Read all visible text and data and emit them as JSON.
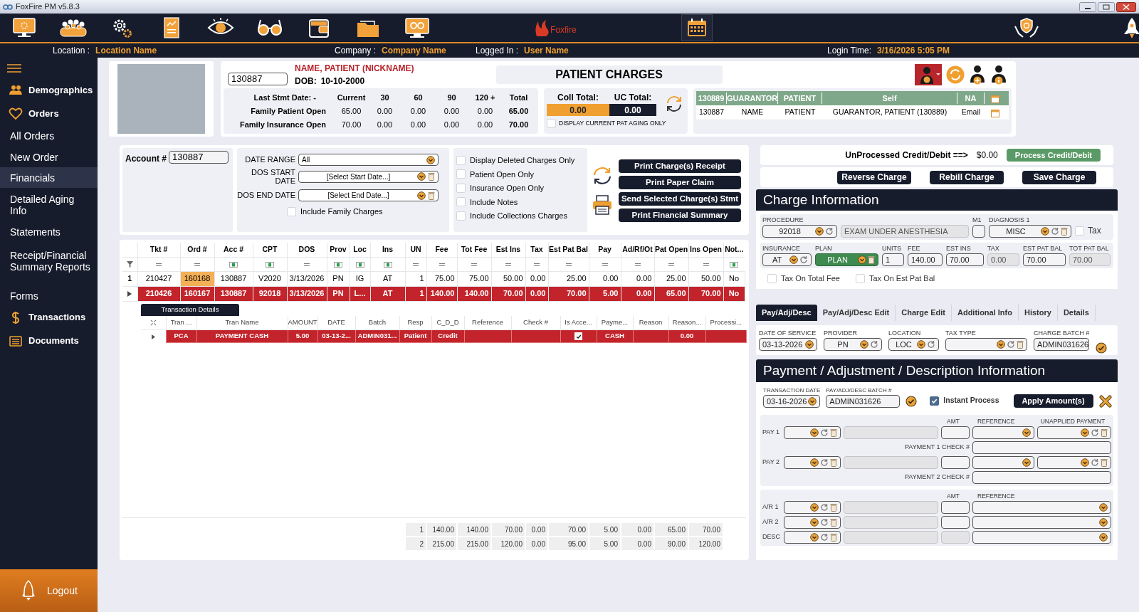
{
  "window": {
    "title": "FoxFire PM v5.8.3"
  },
  "toolbar": {
    "logo": "Foxfire",
    "tools": [
      {
        "selected": false
      },
      {
        "selected": false
      },
      {
        "selected": false
      },
      {
        "selected": false
      },
      {
        "selected": false
      },
      {
        "selected": false
      },
      {
        "selected": false
      },
      {
        "selected": false
      },
      {
        "selected": false
      },
      {
        "selected": true
      },
      {
        "selected": false
      },
      {
        "selected": false
      }
    ]
  },
  "info_bar": [
    {
      "label": "Location :",
      "value": "Location Name"
    },
    {
      "label": "Company :",
      "value": "Company Name"
    },
    {
      "label": "Logged In :",
      "value": "User Name"
    },
    {
      "label": "Login Time:",
      "value": "3/16/2026 5:05 PM"
    }
  ],
  "sidebar": {
    "items": [
      {
        "label": "Demographics",
        "kind": "section",
        "selected": false
      },
      {
        "label": "Orders",
        "kind": "section",
        "selected": false
      },
      {
        "label": "All Orders",
        "kind": "link",
        "selected": false
      },
      {
        "label": "New Order",
        "kind": "link",
        "selected": false
      },
      {
        "label": "Financials",
        "kind": "link",
        "selected": true
      },
      {
        "label": "Detailed Aging Info",
        "kind": "link",
        "selected": false
      },
      {
        "label": "Statements",
        "kind": "link",
        "selected": false
      },
      {
        "label": "Receipt/Financial Summary Reports",
        "kind": "link",
        "selected": false
      },
      {
        "label": "Forms",
        "kind": "link",
        "selected": false
      },
      {
        "label": "Transactions",
        "kind": "section",
        "selected": false
      },
      {
        "label": "Documents",
        "kind": "section",
        "selected": false
      }
    ],
    "logout": "Logout"
  },
  "patient": {
    "account": "130887",
    "name": "NAME, PATIENT (NICKNAME)",
    "dob_label": "DOB:",
    "dob": "10-10-2000"
  },
  "page_title": "PATIENT CHARGES",
  "aging": {
    "last_stmt": "Last Stmt Date: -",
    "columns": [
      "Current",
      "30",
      "60",
      "90",
      "120 +",
      "Total"
    ],
    "rows": [
      {
        "label": "Family Patient Open",
        "values": [
          "65.00",
          "0.00",
          "0.00",
          "0.00",
          "0.00",
          "65.00"
        ]
      },
      {
        "label": "Family Insurance Open",
        "values": [
          "70.00",
          "0.00",
          "0.00",
          "0.00",
          "0.00",
          "70.00"
        ]
      }
    ]
  },
  "collections": {
    "coll_label": "Coll Total:",
    "coll_value": "0.00",
    "uc_label": "UC Total:",
    "uc_value": "0.00",
    "current_aging_only": {
      "label": "DISPLAY CURRENT PAT AGING ONLY",
      "checked": false
    }
  },
  "guarantor_table": {
    "columns": [
      "130889",
      "GUARANTOR",
      "PATIENT",
      "Self",
      "NA"
    ],
    "rows": [
      [
        "130887",
        "NAME",
        "PATIENT",
        "GUARANTOR, PATIENT (130889)",
        "Email"
      ]
    ]
  },
  "filters": {
    "account_label": "Account #",
    "account": "130887",
    "date_range_label": "DATE RANGE",
    "date_range": "All",
    "dos_start_label": "DOS START DATE",
    "dos_start": "[Select Start Date...]",
    "dos_end_label": "DOS END DATE",
    "dos_end": "[Select End Date...]",
    "include_family": {
      "label": "Include Family Charges",
      "checked": false
    }
  },
  "options": [
    {
      "label": "Display Deleted Charges Only",
      "checked": false
    },
    {
      "label": "Patient Open Only",
      "checked": false
    },
    {
      "label": "Insurance Open Only",
      "checked": false
    },
    {
      "label": "Include Notes",
      "checked": false
    },
    {
      "label": "Include Collections Charges",
      "checked": false
    }
  ],
  "print_buttons": [
    "Print Charge(s) Receipt",
    "Print Paper Claim",
    "Send Selected Charge(s) Stmt",
    "Print Financial Summary"
  ],
  "charges": {
    "columns": [
      {
        "label": "Tkt #",
        "kind": "numeric"
      },
      {
        "label": "Ord #",
        "kind": "numeric"
      },
      {
        "label": "Acc #",
        "kind": "text"
      },
      {
        "label": "CPT",
        "kind": "text"
      },
      {
        "label": "DOS",
        "kind": "numeric"
      },
      {
        "label": "Prov",
        "kind": "text"
      },
      {
        "label": "Loc",
        "kind": "text"
      },
      {
        "label": "Ins",
        "kind": "text"
      },
      {
        "label": "UN",
        "kind": "numeric"
      },
      {
        "label": "Fee",
        "kind": "numeric"
      },
      {
        "label": "Tot Fee",
        "kind": "numeric"
      },
      {
        "label": "Est Ins",
        "kind": "numeric"
      },
      {
        "label": "Tax",
        "kind": "numeric"
      },
      {
        "label": "Est Pat Bal",
        "kind": "numeric"
      },
      {
        "label": "Pay",
        "kind": "numeric"
      },
      {
        "label": "Ad/Rf/Ot",
        "kind": "numeric"
      },
      {
        "label": "Pat Open",
        "kind": "numeric"
      },
      {
        "label": "Ins Open",
        "kind": "numeric"
      },
      {
        "label": "Not...",
        "kind": "text"
      }
    ],
    "rows": [
      {
        "number": "1",
        "selected": false,
        "ord_highlighted": true,
        "cells": [
          "210427",
          "160168",
          "130887",
          "V2020",
          "3/13/2026",
          "PN",
          "IG",
          "AT",
          "1",
          "75.00",
          "75.00",
          "50.00",
          "0.00",
          "25.00",
          "0.00",
          "0.00",
          "25.00",
          "50.00",
          "No"
        ]
      },
      {
        "selected": true,
        "ord_highlighted": false,
        "cells": [
          "210426",
          "160167",
          "130887",
          "92018",
          "3/13/2026",
          "PN",
          "L...",
          "AT",
          "1",
          "140.00",
          "140.00",
          "70.00",
          "0.00",
          "70.00",
          "5.00",
          "0.00",
          "65.00",
          "70.00",
          "No"
        ]
      }
    ],
    "totals": [
      {
        "number": "1",
        "values": [
          "140.00",
          "140.00",
          "70.00",
          "0.00",
          "70.00",
          "5.00",
          "0.00",
          "65.00",
          "70.00"
        ]
      },
      {
        "number": "2",
        "values": [
          "215.00",
          "215.00",
          "120.00",
          "0.00",
          "95.00",
          "5.00",
          "0.00",
          "90.00",
          "120.00"
        ]
      }
    ]
  },
  "transactions": {
    "tab": "Transaction Details",
    "columns": [
      "Tran ...",
      "Tran Name",
      "AMOUNT",
      "DATE",
      "Batch",
      "Resp",
      "C_D_D",
      "Reference",
      "Check #",
      "Is Acce...",
      "Payme...",
      "Reason",
      "Reason...",
      "Processi..."
    ],
    "rows": [
      {
        "accepted": true,
        "cells": [
          "PCA",
          "PAYMENT CASH",
          "5.00",
          "03-13-2...",
          "ADMIN031...",
          "Patient",
          "Credit",
          null,
          null,
          null,
          "CASH",
          null,
          "0.00",
          null
        ]
      }
    ]
  },
  "credit": {
    "label": "UnProcessed Credit/Debit ==>",
    "value": "$0.00",
    "button": "Process Credit/Debit"
  },
  "charge_actions": [
    "Reverse Charge",
    "Rebill Charge",
    "Save Charge"
  ],
  "charge_info": {
    "title": "Charge Information",
    "procedure_fields": [
      {
        "label": "PROCEDURE",
        "value": "92018",
        "kind": "select_refresh"
      },
      {
        "value": "EXAM UNDER ANESTHESIA",
        "kind": "readonly"
      },
      {
        "label": "M1",
        "kind": "text"
      },
      {
        "label": "DIAGNOSIS 1",
        "value": "MISC",
        "kind": "lookup"
      },
      {
        "label": "Tax",
        "kind": "checkbox",
        "checked": false
      }
    ],
    "billing_fields": [
      {
        "label": "INSURANCE",
        "value": "AT",
        "kind": "select_refresh"
      },
      {
        "label": "PLAN",
        "value": "PLAN",
        "kind": "select_trash",
        "highlighted": true
      },
      {
        "label": "UNITS",
        "value": "1",
        "kind": "text"
      },
      {
        "label": "FEE",
        "value": "140.00",
        "kind": "text"
      },
      {
        "label": "EST INS",
        "value": "70.00",
        "kind": "text"
      },
      {
        "label": "TAX",
        "value": "0.00",
        "kind": "readonly"
      },
      {
        "label": "EST PAT BAL",
        "value": "70.00",
        "kind": "text"
      },
      {
        "label": "TOT PAT BAL",
        "value": "70.00",
        "kind": "readonly"
      }
    ],
    "tax_options": [
      {
        "label": "Tax On Total Fee",
        "checked": false
      },
      {
        "label": "Tax On Est Pat Bal",
        "checked": false
      }
    ]
  },
  "tabs": [
    {
      "label": "Pay/Adj/Desc",
      "selected": true
    },
    {
      "label": "Pay/Adj/Desc Edit",
      "selected": false
    },
    {
      "label": "Charge Edit",
      "selected": false
    },
    {
      "label": "Additional Info",
      "selected": false
    },
    {
      "label": "History",
      "selected": false
    },
    {
      "label": "Details",
      "selected": false
    }
  ],
  "service_fields": [
    {
      "label": "DATE OF SERVICE",
      "value": "03-13-2026",
      "kind": "date"
    },
    {
      "label": "PROVIDER",
      "value": "PN",
      "kind": "select_refresh"
    },
    {
      "label": "LOCATION",
      "value": "LOC",
      "kind": "select_refresh"
    },
    {
      "label": "TAX TYPE",
      "kind": "lookup"
    },
    {
      "label": "CHARGE BATCH #",
      "value": "ADMIN031626",
      "kind": "text"
    }
  ],
  "payment": {
    "title": "Payment / Adjustment / Description Information",
    "transaction_date": {
      "label": "TRANSACTION DATE",
      "value": "03-16-2026",
      "kind": "date"
    },
    "batch": {
      "label": "PAY/ADJ/DESC BATCH #",
      "value": "ADMIN031626",
      "kind": "text"
    },
    "instant_process": {
      "label": "Instant Process",
      "checked": true
    },
    "apply_button": "Apply Amount(s)",
    "pay_headers": [
      "AMT",
      "REFERENCE",
      "UNAPPLIED PAYMENT"
    ],
    "pay_lines": [
      {
        "label": "PAY 1",
        "check_label": "PAYMENT 1 CHECK #"
      },
      {
        "label": "PAY 2",
        "check_label": "PAYMENT 2 CHECK #"
      }
    ],
    "ar_headers": [
      "AMT",
      "REFERENCE"
    ],
    "ar_lines": [
      {
        "label": "A/R 1",
        "amt_disabled": false
      },
      {
        "label": "A/R 2",
        "amt_disabled": false
      },
      {
        "label": "DESC",
        "amt_disabled": true
      }
    ]
  }
}
